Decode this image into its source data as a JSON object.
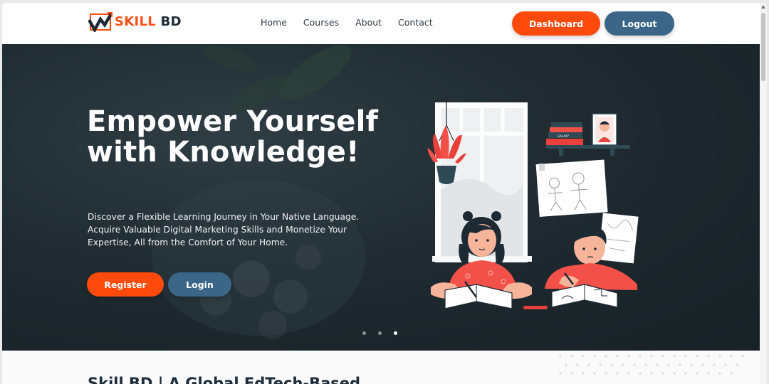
{
  "brand": {
    "name_part1": "SKILL",
    "name_part2": "BD",
    "accent_color": "#ff4a0d",
    "secondary_color": "#3b6688"
  },
  "nav": {
    "links": [
      "Home",
      "Courses",
      "About",
      "Contact"
    ],
    "dashboard_label": "Dashboard",
    "logout_label": "Logout"
  },
  "hero": {
    "title": "Empower Yourself with Knowledge!",
    "description": "Discover a Flexible Learning Journey in Your Native Language. Acquire Valuable Digital Marketing Skills and Monetize Your Expertise, All from the Comfort of Your Home.",
    "register_label": "Register",
    "login_label": "Login",
    "book_label": "GALAXY",
    "carousel": {
      "slides": 3,
      "active_index": 2
    }
  },
  "section": {
    "title": "Skill BD | A Global EdTech-Based"
  }
}
